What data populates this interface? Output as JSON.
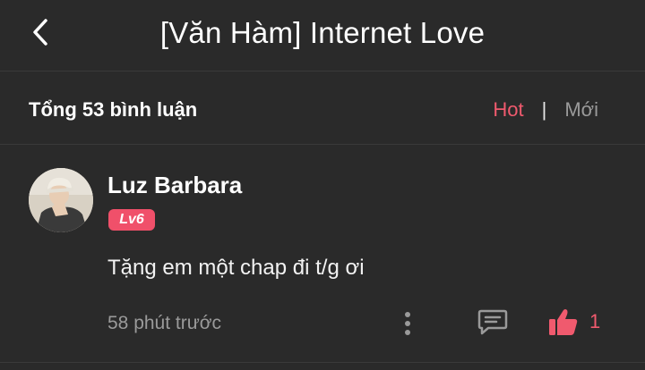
{
  "header": {
    "back_icon": "chevron-left-icon",
    "title": "[Văn Hàm] Internet Love"
  },
  "summary": {
    "total_label": "Tổng 53 bình luận",
    "sort_options": [
      "Hot",
      "Mới"
    ],
    "sort_separator": "|",
    "active_sort": "Hot"
  },
  "comment": {
    "username": "Luz Barbara",
    "level": "Lv6",
    "text": "Tặng em một chap đi t/g ơi",
    "time": "58 phút trước",
    "like_count": "1",
    "icons": {
      "more": "more-vertical-icon",
      "reply": "comment-icon",
      "like": "thumbs-up-icon"
    }
  },
  "colors": {
    "background": "#2a2a2a",
    "accent": "#f05a6e",
    "muted": "#9a9a9a"
  }
}
